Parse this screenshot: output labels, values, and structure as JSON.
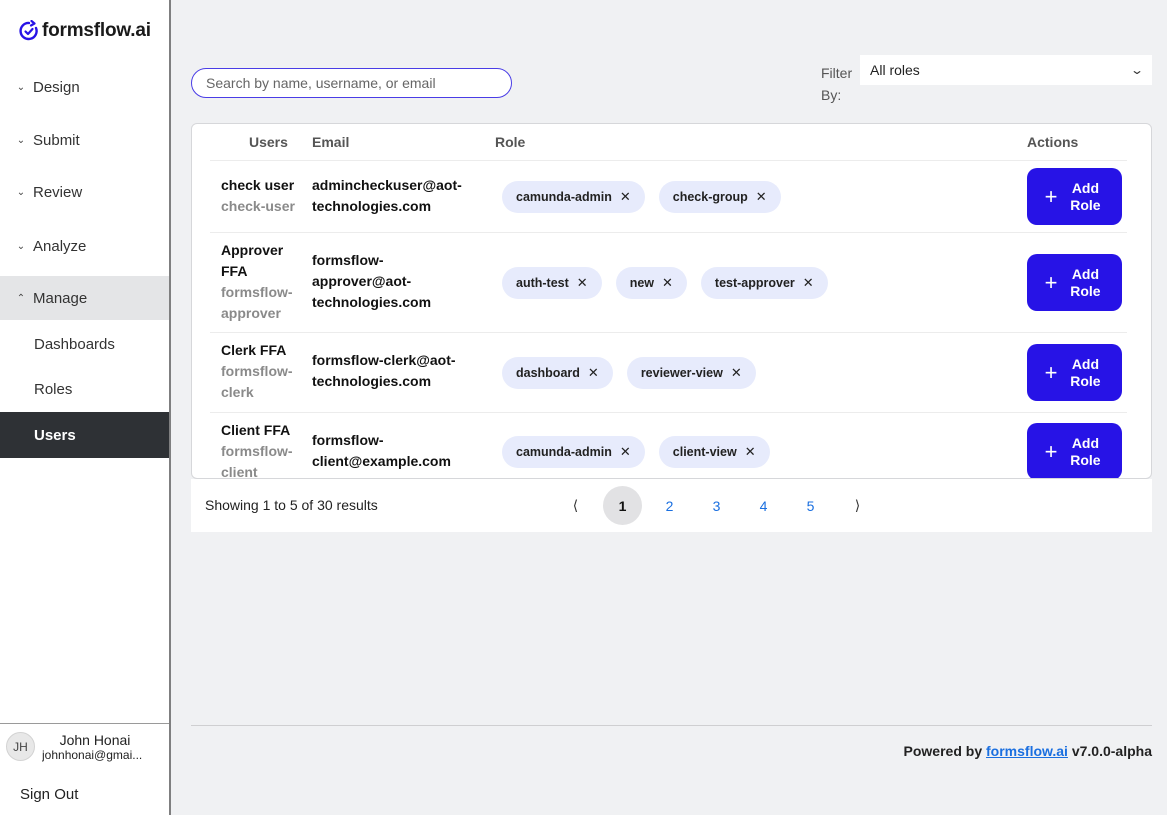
{
  "brand": {
    "name": "formsflow.ai",
    "accent": "#2713e6"
  },
  "nav": {
    "items": [
      {
        "label": "Design",
        "icon": "chevron-down-icon"
      },
      {
        "label": "Submit",
        "icon": "chevron-down-icon"
      },
      {
        "label": "Review",
        "icon": "chevron-down-icon"
      },
      {
        "label": "Analyze",
        "icon": "chevron-down-icon"
      },
      {
        "label": "Manage",
        "icon": "chevron-up-icon"
      }
    ],
    "manage_sub": [
      {
        "label": "Dashboards"
      },
      {
        "label": "Roles"
      },
      {
        "label": "Users"
      }
    ]
  },
  "user": {
    "initials": "JH",
    "name": "John Honai",
    "email": "johnhonai@gmai...",
    "sign_out": "Sign Out"
  },
  "search": {
    "placeholder": "Search by name, username, or email"
  },
  "filter": {
    "label": "Filter By:",
    "value": "All roles"
  },
  "table": {
    "headers": {
      "users": "Users",
      "email": "Email",
      "role": "Role",
      "actions": "Actions"
    },
    "add_role_label": "Add Role",
    "rows": [
      {
        "name": "check user",
        "username": "check-user",
        "email": "admincheckuser@aot-technologies.com",
        "roles": [
          "camunda-admin",
          "check-group"
        ]
      },
      {
        "name": "Approver FFA",
        "username": "formsflow-approver",
        "email": "formsflow-approver@aot-technologies.com",
        "roles": [
          "auth-test",
          "new",
          "test-approver"
        ]
      },
      {
        "name": "Clerk FFA",
        "username": "formsflow-clerk",
        "email": "formsflow-clerk@aot-technologies.com",
        "roles": [
          "dashboard",
          "reviewer-view"
        ]
      },
      {
        "name": "Client FFA",
        "username": "formsflow-client",
        "email": "formsflow-client@example.com",
        "roles": [
          "camunda-admin",
          "client-view"
        ]
      }
    ]
  },
  "pagination": {
    "summary": "Showing 1 to 5 of 30 results",
    "prev": "⟨",
    "next": "⟩",
    "pages": [
      "1",
      "2",
      "3",
      "4",
      "5"
    ],
    "current": "1"
  },
  "footer": {
    "prefix": "Powered by",
    "link": "formsflow.ai",
    "version": "v7.0.0-alpha"
  }
}
